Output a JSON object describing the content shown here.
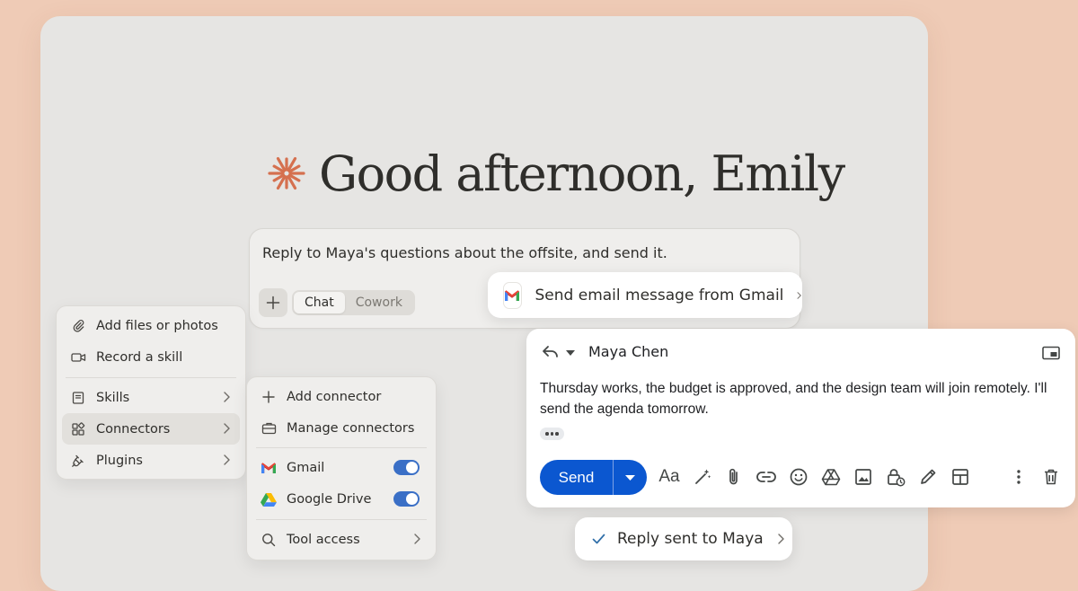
{
  "greeting": {
    "text": "Good afternoon, Emily"
  },
  "prompt": {
    "text": "Reply to Maya's questions about the offsite, and send it.",
    "modes": [
      "Chat",
      "Cowork"
    ]
  },
  "attach_menu": {
    "items": [
      {
        "label": "Add files or photos",
        "icon": "paperclip-icon"
      },
      {
        "label": "Record a skill",
        "icon": "video-camera-icon"
      },
      {
        "label": "Skills",
        "icon": "book-icon"
      },
      {
        "label": "Connectors",
        "icon": "grid-icon"
      },
      {
        "label": "Plugins",
        "icon": "plug-icon"
      }
    ]
  },
  "connectors_menu": {
    "items": [
      {
        "label": "Add connector",
        "icon": "plus-icon"
      },
      {
        "label": "Manage connectors",
        "icon": "briefcase-icon"
      },
      {
        "label": "Gmail",
        "icon": "gmail-icon",
        "enabled": true
      },
      {
        "label": "Google Drive",
        "icon": "google-drive-icon",
        "enabled": true
      },
      {
        "label": "Tool access",
        "icon": "search-icon"
      }
    ]
  },
  "tool_call": {
    "label": "Send email message from Gmail",
    "icon": "gmail-icon"
  },
  "email": {
    "recipient": "Maya Chen",
    "body": "Thursday works, the budget is approved, and the design team will join remotely. I'll send the agenda tomorrow.",
    "send_label": "Send",
    "format_label": "Aa"
  },
  "result": {
    "label": "Reply sent to Maya",
    "icon": "check-icon"
  },
  "colors": {
    "background": "#efcbb6",
    "panel": "#e6e5e3",
    "accent": "#d5704f",
    "send_button": "#0b57d0",
    "toggle_on": "#3a6fc6"
  }
}
